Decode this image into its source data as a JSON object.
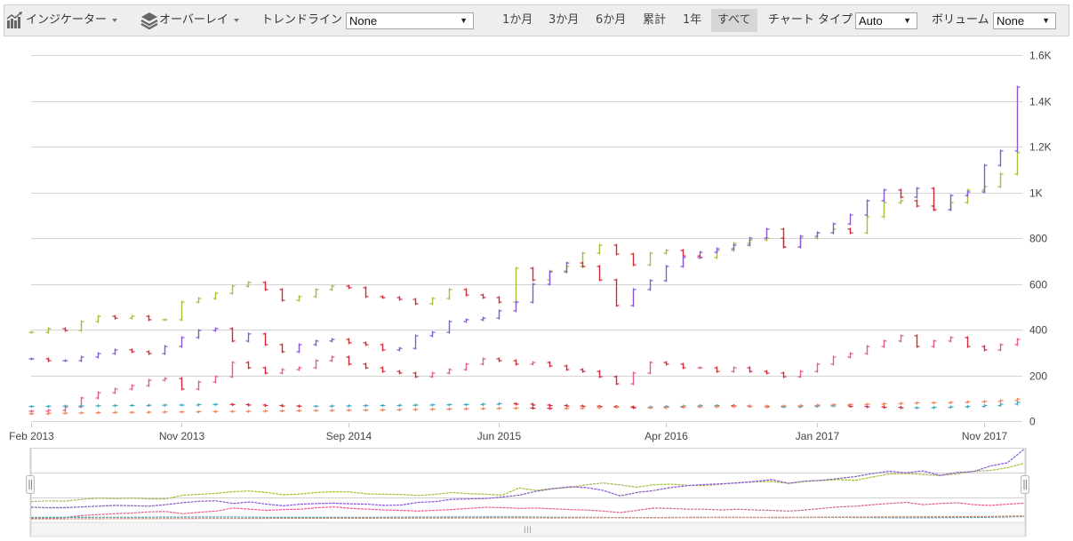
{
  "toolbar": {
    "indicators_label": "インジケーター",
    "overlays_label": "オーバーレイ",
    "trendline_label": "トレンドライン",
    "trendline_value": "None",
    "ranges": [
      "1か月",
      "3か月",
      "6か月",
      "累計",
      "1年",
      "すべて"
    ],
    "active_range": "すべて",
    "chart_type_label": "チャート タイプ",
    "chart_type_value": "Auto",
    "volume_label": "ボリューム",
    "volume_value": "None",
    "icons": {
      "indicators": "bar-chart-trend-icon",
      "overlays": "layers-icon",
      "dropdown": "triangle-down-icon"
    }
  },
  "colors": {
    "down": "#d22a36",
    "grid": "#d4d4d4",
    "axis_text": "#444444"
  },
  "chart_data": {
    "type": "hlc-bar",
    "title": "",
    "xlabel": "",
    "ylabel": "",
    "x_start": "Feb 2013",
    "x_step": "month",
    "ylim": [
      0,
      1600
    ],
    "grid": true,
    "legend": "none",
    "y_ticks": [
      {
        "value": 0,
        "label": "0"
      },
      {
        "value": 200,
        "label": "200"
      },
      {
        "value": 400,
        "label": "400"
      },
      {
        "value": 600,
        "label": "600"
      },
      {
        "value": 800,
        "label": "800"
      },
      {
        "value": 1000,
        "label": "1K"
      },
      {
        "value": 1200,
        "label": "1.2K"
      },
      {
        "value": 1400,
        "label": "1.4K"
      },
      {
        "value": 1600,
        "label": "1.6K"
      }
    ],
    "x_ticks": [
      {
        "index": 0,
        "label": "Feb 2013"
      },
      {
        "index": 9,
        "label": "Nov 2013"
      },
      {
        "index": 19,
        "label": "Sep 2014"
      },
      {
        "index": 28,
        "label": "Jun 2015"
      },
      {
        "index": 38,
        "label": "Apr 2016"
      },
      {
        "index": 47,
        "label": "Jan 2017"
      },
      {
        "index": 57,
        "label": "Nov 2017"
      }
    ],
    "series": [
      {
        "name": "series-green",
        "color": "#a3bf3a",
        "values": [
          388,
          404,
          396,
          435,
          458,
          450,
          458,
          443,
          443,
          520,
          536,
          559,
          590,
          606,
          575,
          528,
          544,
          575,
          590,
          583,
          544,
          540,
          532,
          513,
          536,
          575,
          551,
          540,
          520,
          668,
          617,
          656,
          676,
          734,
          769,
          730,
          683,
          734,
          746,
          722,
          715,
          746,
          777,
          792,
          800,
          761,
          800,
          823,
          839,
          823,
          893,
          955,
          963,
          940,
          924,
          955,
          1010,
          1025,
          1080,
          1173
        ]
      },
      {
        "name": "series-purple",
        "color": "#8757d4",
        "values": [
          272,
          264,
          264,
          280,
          295,
          311,
          303,
          295,
          326,
          365,
          396,
          404,
          350,
          381,
          334,
          303,
          334,
          350,
          357,
          342,
          334,
          311,
          318,
          373,
          388,
          435,
          443,
          450,
          482,
          520,
          598,
          652,
          691,
          676,
          617,
          505,
          575,
          614,
          676,
          715,
          738,
          753,
          769,
          800,
          839,
          761,
          808,
          823,
          862,
          901,
          963,
          1010,
          979,
          1017,
          924,
          986,
          1002,
          1118,
          1181,
          1460
        ]
      },
      {
        "name": "series-pink",
        "color": "#e35b8e",
        "values": [
          43,
          47,
          62,
          101,
          124,
          140,
          155,
          179,
          186,
          140,
          171,
          194,
          256,
          233,
          210,
          225,
          233,
          264,
          280,
          249,
          233,
          217,
          210,
          194,
          210,
          225,
          249,
          272,
          264,
          249,
          256,
          241,
          225,
          217,
          194,
          163,
          210,
          256,
          249,
          233,
          233,
          217,
          233,
          217,
          210,
          194,
          217,
          249,
          280,
          295,
          326,
          350,
          373,
          326,
          350,
          365,
          326,
          311,
          334,
          357
        ]
      },
      {
        "name": "series-teal",
        "color": "#3fa8c2",
        "values": [
          64,
          65,
          66,
          66,
          67,
          68,
          68,
          69,
          70,
          70,
          72,
          73,
          72,
          70,
          68,
          66,
          65,
          65,
          66,
          67,
          68,
          68,
          69,
          70,
          71,
          72,
          72,
          74,
          76,
          74,
          70,
          68,
          66,
          65,
          64,
          62,
          60,
          62,
          64,
          66,
          68,
          68,
          66,
          64,
          62,
          62,
          64,
          66,
          66,
          64,
          62,
          60,
          58,
          58,
          60,
          62,
          64,
          68,
          74,
          82
        ]
      },
      {
        "name": "series-orange",
        "color": "#f0845a",
        "values": [
          32,
          34,
          35,
          36,
          37,
          38,
          38,
          39,
          40,
          40,
          41,
          42,
          42,
          43,
          44,
          45,
          46,
          46,
          47,
          48,
          48,
          49,
          50,
          51,
          52,
          53,
          54,
          55,
          56,
          57,
          56,
          55,
          56,
          58,
          60,
          60,
          58,
          58,
          60,
          62,
          62,
          63,
          64,
          64,
          66,
          66,
          68,
          70,
          72,
          72,
          74,
          76,
          78,
          80,
          80,
          82,
          84,
          86,
          90,
          96
        ]
      }
    ]
  },
  "navigator": {
    "selected_range": "all",
    "scrollbar_grip": "III"
  }
}
